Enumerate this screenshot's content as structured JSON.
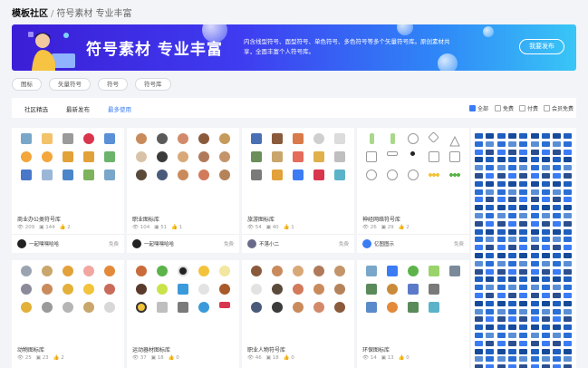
{
  "breadcrumb": {
    "root": "模板社区",
    "sep": "/",
    "current": "符号素材 专业丰富"
  },
  "banner": {
    "title": "符号素材 专业丰富",
    "desc": "内含线型符号、面型符号、单色符号、多色符号等多个矢量符号库。原创素材共享，全面丰富个人符号库。",
    "button": "我要发布"
  },
  "chips": [
    "图标",
    "矢量符号",
    "符号",
    "符号库"
  ],
  "tabs": [
    "社区精选",
    "最新发布",
    "最多使用"
  ],
  "filters": [
    "全部",
    "免费",
    "付费",
    "会员免费"
  ],
  "colors": {
    "accent": "#3b7cf5"
  },
  "cards": [
    {
      "title": "商业办公类符号库",
      "views": "209",
      "favs": "144",
      "likes": "2",
      "author": "一起嘿嘿哈哈",
      "price": "免费"
    },
    {
      "title": "职业图标库",
      "views": "104",
      "favs": "51",
      "likes": "1",
      "author": "一起嘿嘿哈哈",
      "price": "免费"
    },
    {
      "title": "旅游图标库",
      "views": "54",
      "favs": "40",
      "likes": "1",
      "author": "不落小二",
      "price": "免费"
    },
    {
      "title": "神经网络符号库",
      "views": "26",
      "favs": "29",
      "likes": "2",
      "author": "亿图图示",
      "price": "免费"
    },
    {
      "title": "动物图标库",
      "views": "25",
      "favs": "23",
      "likes": "2",
      "author": "",
      "price": ""
    },
    {
      "title": "运动器材图标库",
      "views": "37",
      "favs": "18",
      "likes": "0",
      "author": "",
      "price": ""
    },
    {
      "title": "职业人物符号库",
      "views": "46",
      "favs": "18",
      "likes": "0",
      "author": "",
      "price": ""
    },
    {
      "title": "环保图标库",
      "views": "14",
      "favs": "13",
      "likes": "0",
      "author": "",
      "price": ""
    }
  ]
}
